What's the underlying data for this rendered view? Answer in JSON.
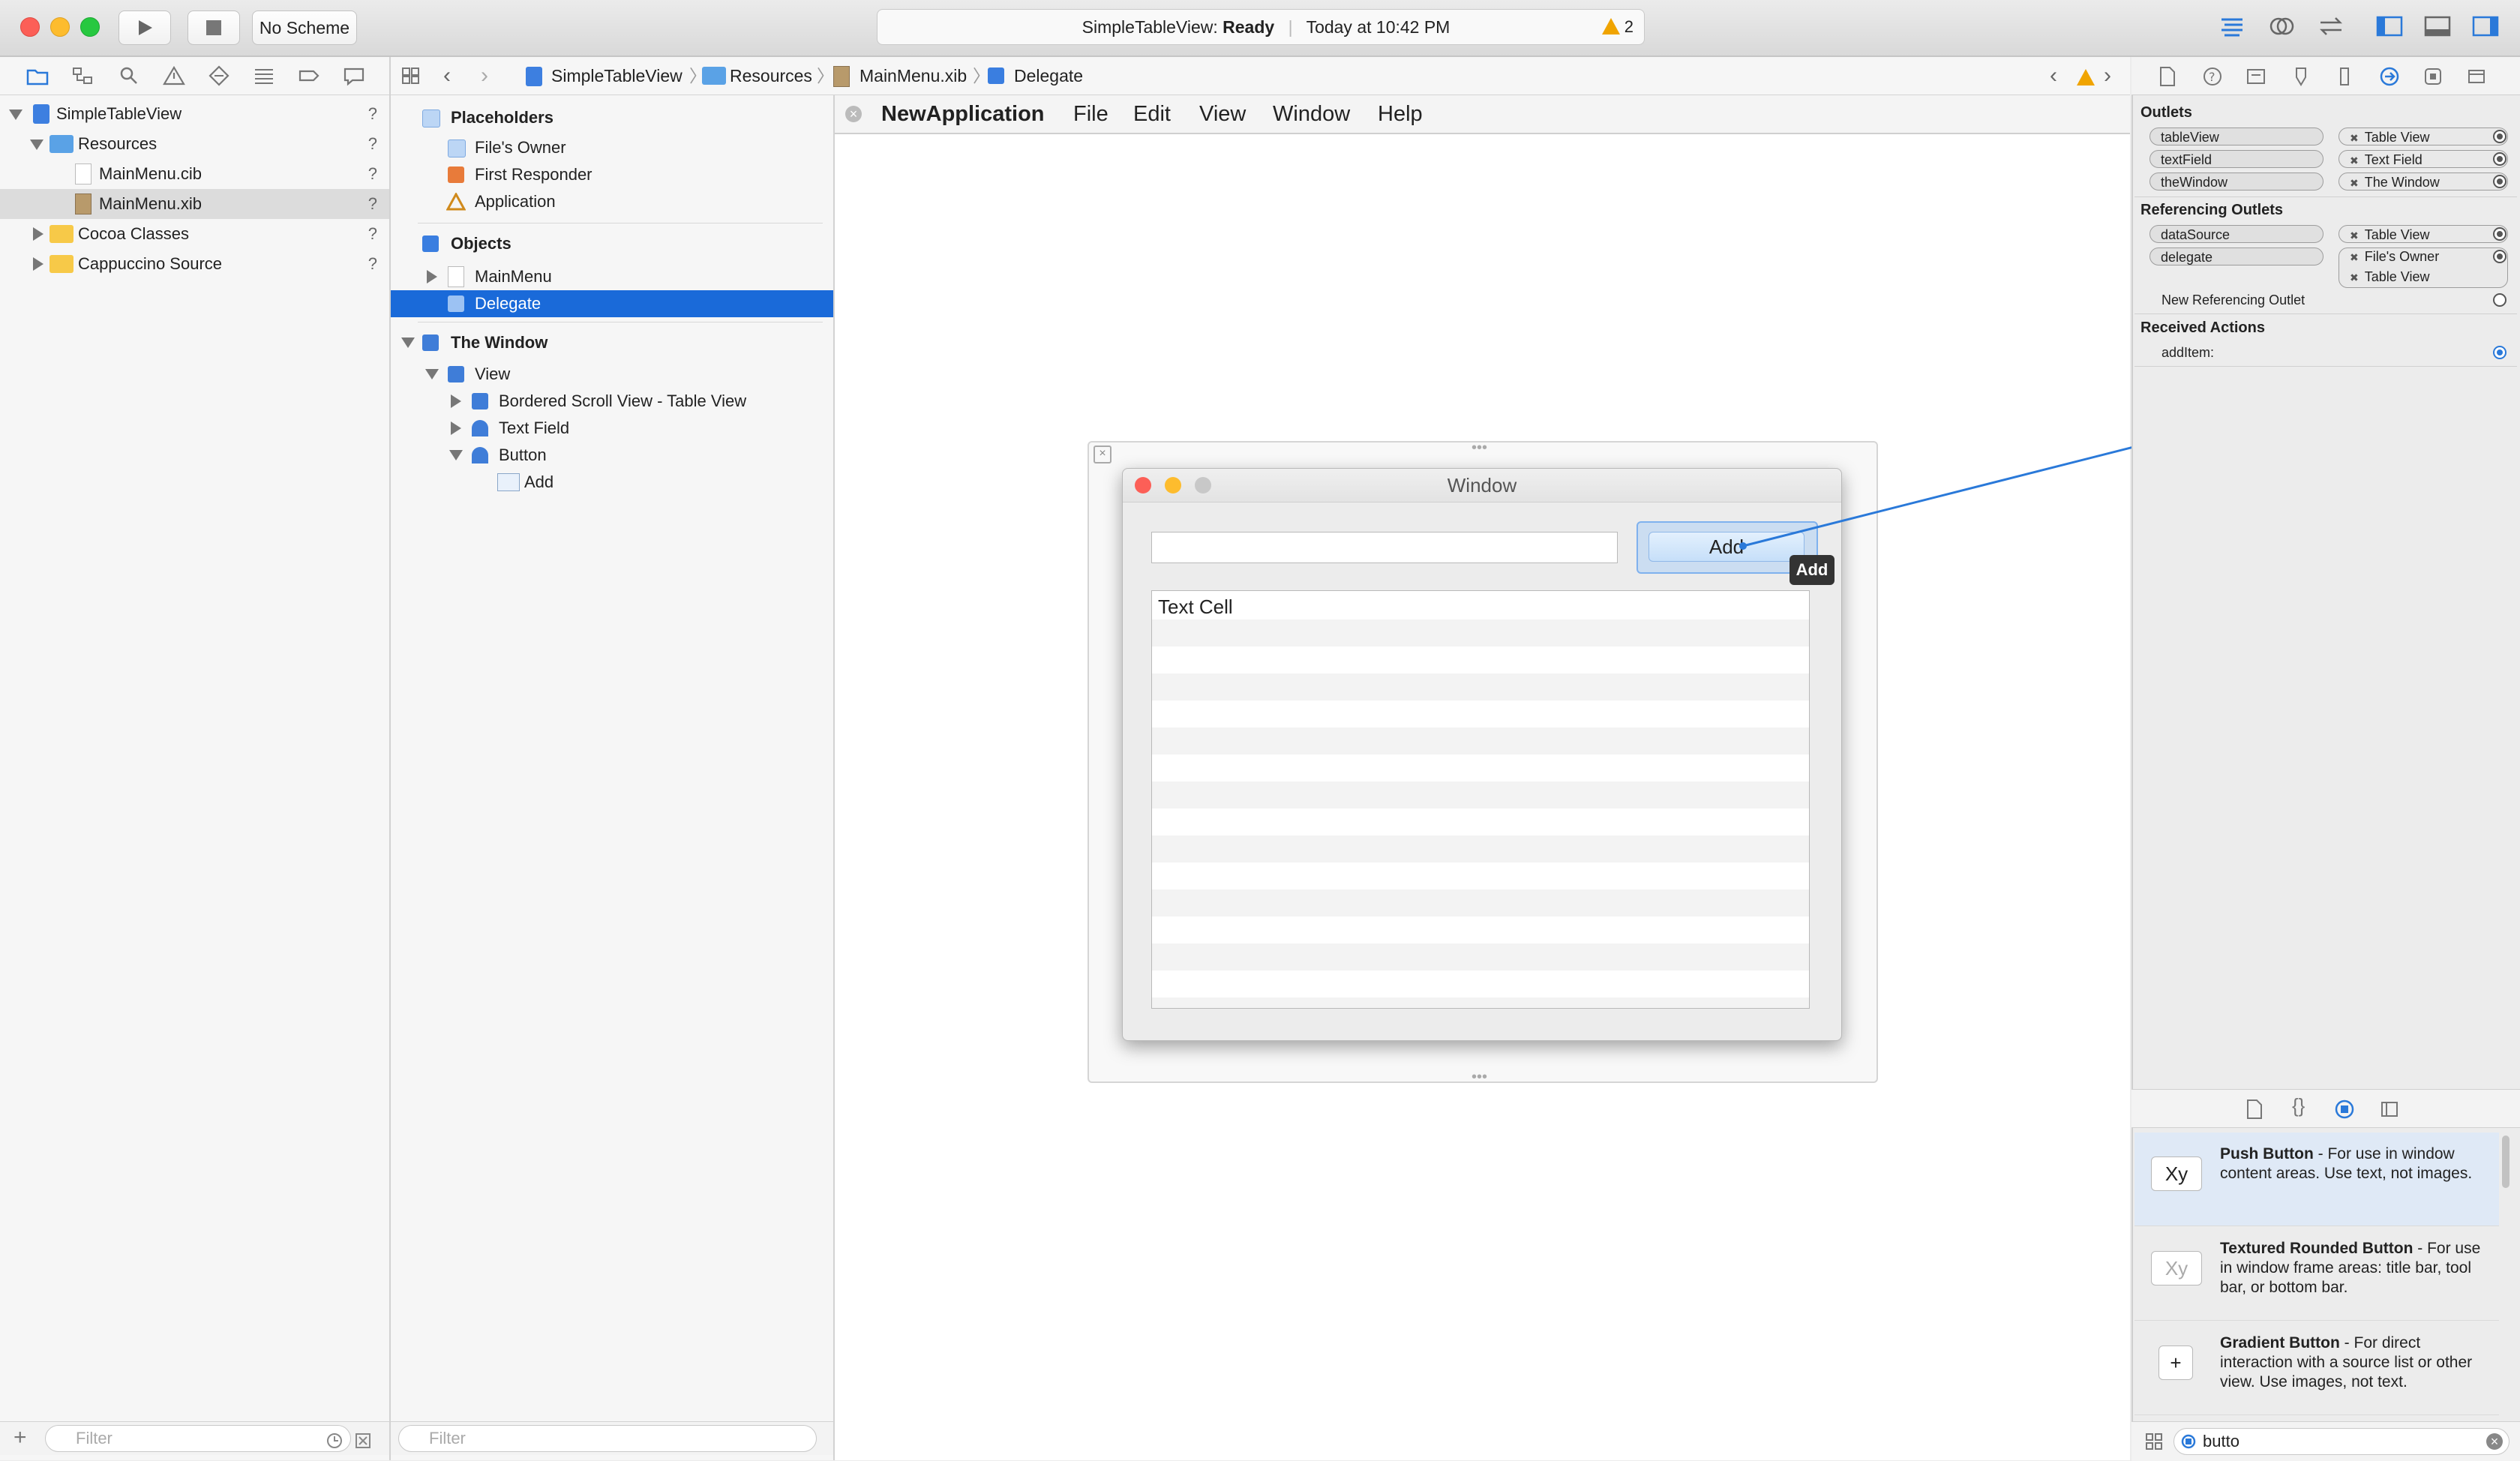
{
  "toolbar": {
    "scheme": "No Scheme",
    "activity_app": "SimpleTableView:",
    "activity_status": "Ready",
    "activity_time": "Today at 10:42 PM",
    "warning_count": "2"
  },
  "navigator": {
    "items": [
      {
        "label": "SimpleTableView",
        "badge": "?"
      },
      {
        "label": "Resources",
        "badge": "?"
      },
      {
        "label": "MainMenu.cib",
        "badge": "?"
      },
      {
        "label": "MainMenu.xib",
        "badge": "?"
      },
      {
        "label": "Cocoa Classes",
        "badge": "?"
      },
      {
        "label": "Cappuccino Source",
        "badge": "?"
      }
    ],
    "filter_placeholder": "Filter"
  },
  "jumpbar": {
    "crumbs": [
      "SimpleTableView",
      "Resources",
      "MainMenu.xib",
      "Delegate"
    ]
  },
  "outline": {
    "placeholders_header": "Placeholders",
    "placeholders": [
      "File's Owner",
      "First Responder",
      "Application"
    ],
    "objects_header": "Objects",
    "objects": [
      "MainMenu",
      "Delegate"
    ],
    "window_header": "The Window",
    "window_items": [
      "View",
      "Bordered Scroll View - Table View",
      "Text Field",
      "Button",
      "Add"
    ],
    "filter_placeholder": "Filter"
  },
  "canvas": {
    "menubar": {
      "app": "NewApplication",
      "items": [
        "File",
        "Edit",
        "View",
        "Window",
        "Help"
      ]
    },
    "window_title": "Window",
    "button_label": "Add",
    "tooltip": "Add",
    "cell_text": "Text Cell"
  },
  "inspector": {
    "outlets_header": "Outlets",
    "outlets": [
      {
        "name": "tableView",
        "target": "Table View"
      },
      {
        "name": "textField",
        "target": "Text Field"
      },
      {
        "name": "theWindow",
        "target": "The Window"
      }
    ],
    "referencing_header": "Referencing Outlets",
    "referencing": [
      {
        "name": "dataSource",
        "targets": [
          "Table View"
        ]
      },
      {
        "name": "delegate",
        "targets": [
          "File's Owner",
          "Table View"
        ]
      }
    ],
    "new_referencing": "New Referencing Outlet",
    "actions_header": "Received Actions",
    "actions": [
      {
        "name": "addItem:"
      }
    ]
  },
  "library": {
    "items": [
      {
        "icon": "Xy",
        "title": "Push Button",
        "desc": " - For use in window content areas. Use text, not images."
      },
      {
        "icon": "Xy",
        "title": "Textured Rounded Button",
        "desc": " - For use in window frame areas: title bar, tool bar, or bottom bar."
      },
      {
        "icon": "+",
        "title": "Gradient Button",
        "desc": " - For direct interaction with a source list or other view. Use images, not text."
      }
    ],
    "search_value": "butto"
  },
  "colors": {
    "selection": "#1a6ad9",
    "connection": "#2a79d9",
    "warning": "#f0a400"
  }
}
